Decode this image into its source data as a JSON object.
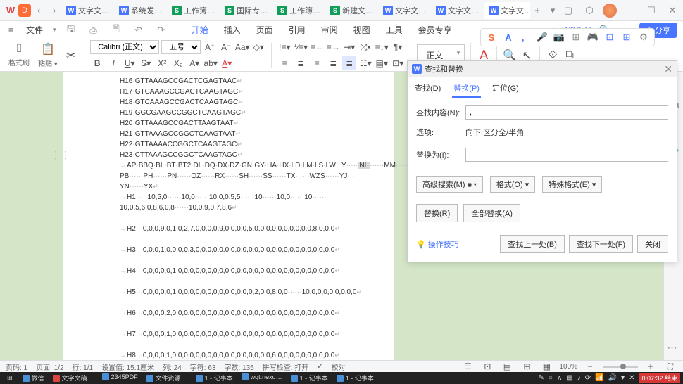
{
  "titlebar": {
    "tabs": [
      {
        "icon": "W",
        "color": "#4876ff",
        "label": "文字文…"
      },
      {
        "icon": "W",
        "color": "#4876ff",
        "label": "系统发…"
      },
      {
        "icon": "S",
        "color": "#0f9d58",
        "label": "工作簿…"
      },
      {
        "icon": "S",
        "color": "#0f9d58",
        "label": "国际专…"
      },
      {
        "icon": "S",
        "color": "#0f9d58",
        "label": "工作簿…"
      },
      {
        "icon": "S",
        "color": "#0f9d58",
        "label": "新建文…"
      },
      {
        "icon": "W",
        "color": "#4876ff",
        "label": "文字文…"
      },
      {
        "icon": "W",
        "color": "#4876ff",
        "label": "文字文…"
      },
      {
        "icon": "W",
        "color": "#4876ff",
        "label": "文字文…",
        "active": true,
        "dirty": "•"
      }
    ]
  },
  "menubar": {
    "file": "文件",
    "items": [
      "开始",
      "插入",
      "页面",
      "引用",
      "审阅",
      "视图",
      "工具",
      "会员专享"
    ],
    "active": "开始",
    "wps_ai": "WPS AI",
    "share": "分享"
  },
  "toolbar": {
    "brush": "格式刷",
    "paste": "粘贴",
    "font_name": "Calibri (正文)",
    "font_size": "五号",
    "style": "正文"
  },
  "dialog": {
    "title": "查找和替换",
    "tabs": {
      "find": "查找(D)",
      "replace": "替换(P)",
      "goto": "定位(G)"
    },
    "active_tab": "替换(P)",
    "find_label": "查找内容(N):",
    "find_value": ",",
    "options_label": "选项:",
    "options_value": "向下,区分全/半角",
    "replace_label": "替换为(I):",
    "replace_value": "",
    "adv_search": "高级搜索(M)",
    "format": "格式(O)",
    "special": "特殊格式(E)",
    "replace_btn": "替换(R)",
    "replace_all": "全部替换(A)",
    "tips": "操作技巧",
    "find_prev": "查找上一处(B)",
    "find_next": "查找下一处(F)",
    "close": "关闭"
  },
  "document": {
    "lines": [
      "H16·GTTAAAGCCGACTCGAGTAAC↵",
      "H17·GTCAAAGCCGACTCAAGTAGC↵",
      "H18·GTCAAAGCCGACTCAAGTAGC↵",
      "H19·GGCGAAGCCGGCTCAAGTAGC↵",
      "H20·GTTAAAGCCGACTTAAGTAAT↵",
      "H21·GTTAAAGCCGGCTCAAGTAAT↵",
      "H22·GTTAAAACCGGCTCAAGTAGC↵",
      "H23·CTTAAAGCCGGCTCAAGTAGC↵",
      "→AP·BBQ·BL·BT·BT2·DL·DQ·DX·DZ·GN·GY·HA·HX·LD·LM·LS·LW·LY·····NL······MM······NN···",
      "PB······PH······PN······QZ······RX······SH······SS······TX······WZS······YJ···",
      "YN······YX↵",
      "→H1·····10,5,0······10,0······10,0,0,5,5······10······10,0······10······",
      "10,0,5,6,0,8,6,0,8······10,0,9,0,7,8,6↵",
      "",
      "→H2···0,0,0,9,0,1,0,2,7,0,0,0,0,9,0,0,0,0,5,0,0,0,0,0,0,0,0,0,0,8,0,0,0↵",
      "",
      "→H3···0,0,0,1,0,0,0,0,3,0,0,0,0,0,0,0,0,0,0,0,0,0,0,0,0,0,0,0,0,0,0,0,0↵",
      "",
      "→H4···0,0,0,0,0,1,0,0,0,0,0,0,0,0,0,0,0,0,0,0,0,0,0,0,0,0,0,0,0,0,0,0,0↵",
      "",
      "→H5···0,0,0,0,0,1,0,0,0,0,0,0,0,0,0,0,0,0,0,2,0,0,8,0,0······10,0,0,0,0,0,0,0,0↵",
      "",
      "→H6···0,0,0,0,2,0,0,0,0,0,0,0,0,0,0,0,0,0,0,0,0,0,0,0,0,0,0,0,0,0,0,0,0↵",
      "",
      "→H7···0,0,0,0,1,0,0,0,0,0,0,0,0,0,0,0,0,0,0,0,0,0,0,0,0,0,0,0,0,0,0,0,0↵",
      "",
      "→H8···0,0,0,0,1,0,0,0,0,0,0,0,0,0,0,0,0,0,0,0,0,0,6,0,0,0,0,0,0,0,0,0,0↵"
    ]
  },
  "statusbar": {
    "page": "页码: 1",
    "pages": "页面: 1/2",
    "lines": "行: 1/1",
    "setval": "设置值: 15.1厘米",
    "col": "列: 24",
    "chars": "字符: 63",
    "wordcount": "字数: 135",
    "spell": "拼写检查: 打开",
    "proof": "校对",
    "zoom": "100%"
  },
  "taskbar": {
    "items": [
      {
        "label": "微信"
      },
      {
        "label": "文字文稿…",
        "color": "#d44"
      },
      {
        "label": "2345PDF"
      },
      {
        "label": "文件资源…"
      },
      {
        "label": "1 - 记事本"
      },
      {
        "label": "wgt.nexu…"
      },
      {
        "label": "1 - 记事本"
      },
      {
        "label": "1 - 记事本"
      }
    ],
    "time": "0:07:32 结束"
  },
  "floating": {
    "s": "S",
    "a": "A"
  }
}
